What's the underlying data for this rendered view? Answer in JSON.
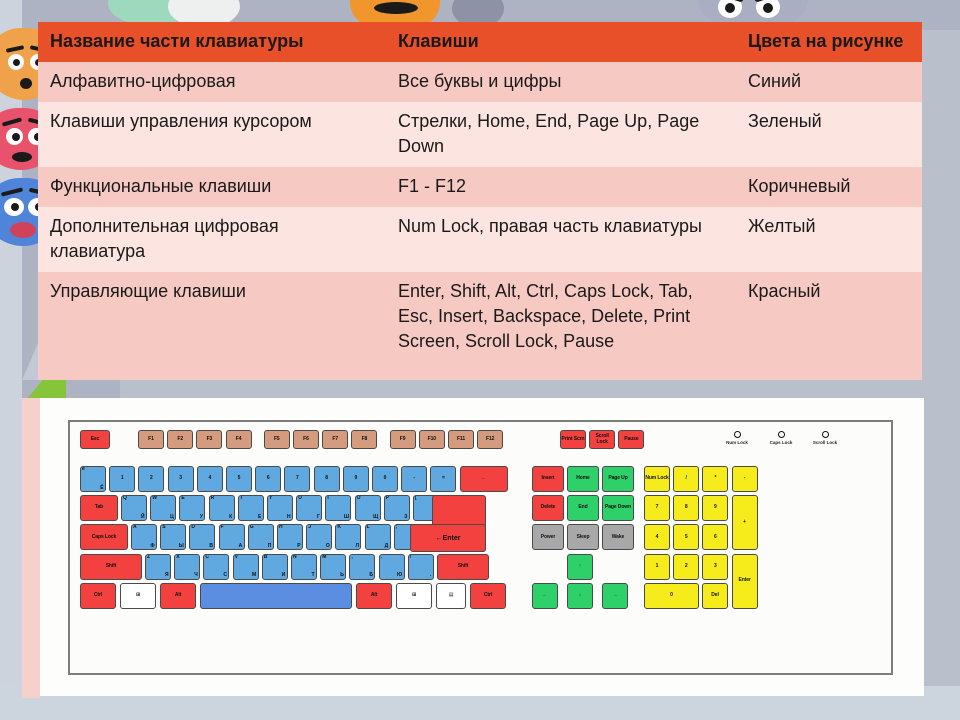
{
  "table": {
    "headers": [
      "Название части клавиатуры",
      "Клавиши",
      "Цвета на рисунке"
    ],
    "header_bg": "#e8502a",
    "rows": [
      {
        "part": "Алфавитно-цифровая",
        "keys": "Все буквы и цифры",
        "color": "Синий"
      },
      {
        "part": "Клавиши управления курсором",
        "keys": "Стрелки, Home, End, Page Up, Page Down",
        "color": "Зеленый"
      },
      {
        "part": "Функциональные клавиши",
        "keys": "F1 - F12",
        "color": "Коричневый"
      },
      {
        "part": "Дополнительная цифровая клавиатура",
        "keys": "Num Lock, правая часть клавиатуры",
        "color": "Желтый"
      },
      {
        "part": "Управляющие клавиши",
        "keys": "Enter, Shift, Alt, Ctrl, Caps Lock, Tab, Esc, Insert, Backspace, Delete, Print Screen, Scroll Lock, Pause",
        "color": "Красный"
      }
    ]
  },
  "keyboard": {
    "legend_colors": {
      "alphanumeric": "#5fa8e0",
      "cursor": "#2ed06a",
      "function": "#d49b7e",
      "numpad": "#f7ec1b",
      "control": "#f2413f",
      "other": "#a8a8a8"
    },
    "leds": [
      "Num Lock",
      "Caps Lock",
      "Scroll Lock"
    ],
    "rows": {
      "function_row": [
        "Esc",
        "F1",
        "F2",
        "F3",
        "F4",
        "F5",
        "F6",
        "F7",
        "F8",
        "F9",
        "F10",
        "F11",
        "F12",
        "Print Scrn",
        "Scroll Lock",
        "Pause"
      ],
      "number_row": [
        "ё",
        "1",
        "2",
        "3",
        "4",
        "5",
        "6",
        "7",
        "8",
        "9",
        "0",
        "-",
        "=",
        "Backspace",
        "Insert",
        "Home",
        "Page Up",
        "Num Lock",
        "/",
        "*",
        "-"
      ],
      "qwerty_row": [
        "Tab",
        "Q",
        "W",
        "E",
        "R",
        "T",
        "Y",
        "U",
        "I",
        "O",
        "P",
        "[",
        "]",
        "Delete",
        "End",
        "Page Down",
        "7",
        "8",
        "9",
        "+"
      ],
      "home_row": [
        "Caps Lock",
        "A",
        "S",
        "D",
        "F",
        "G",
        "H",
        "J",
        "K",
        "L",
        ";",
        "'",
        "Enter",
        "Power",
        "Sleep",
        "Wake",
        "4",
        "5",
        "6"
      ],
      "shift_row": [
        "Shift",
        "Z",
        "X",
        "C",
        "V",
        "B",
        "N",
        "M",
        ",",
        ".",
        "/",
        "Shift",
        "Up",
        "1",
        "2",
        "3",
        "Enter"
      ],
      "bottom_row": [
        "Ctrl",
        "Win",
        "Alt",
        "Space",
        "Alt",
        "Win",
        "Menu",
        "Ctrl",
        "Left",
        "Down",
        "Right",
        "0",
        "Del"
      ]
    },
    "cyrillic_row1": [
      "Й",
      "Ц",
      "У",
      "К",
      "Е",
      "Н",
      "Г",
      "Ш",
      "Щ",
      "З",
      "Х",
      "Ъ"
    ],
    "cyrillic_row2": [
      "Ф",
      "Ы",
      "В",
      "А",
      "П",
      "Р",
      "О",
      "Л",
      "Д",
      "Ж",
      "Э"
    ],
    "cyrillic_row3": [
      "Я",
      "Ч",
      "С",
      "М",
      "И",
      "Т",
      "Ь",
      "Б",
      "Ю",
      "."
    ]
  }
}
